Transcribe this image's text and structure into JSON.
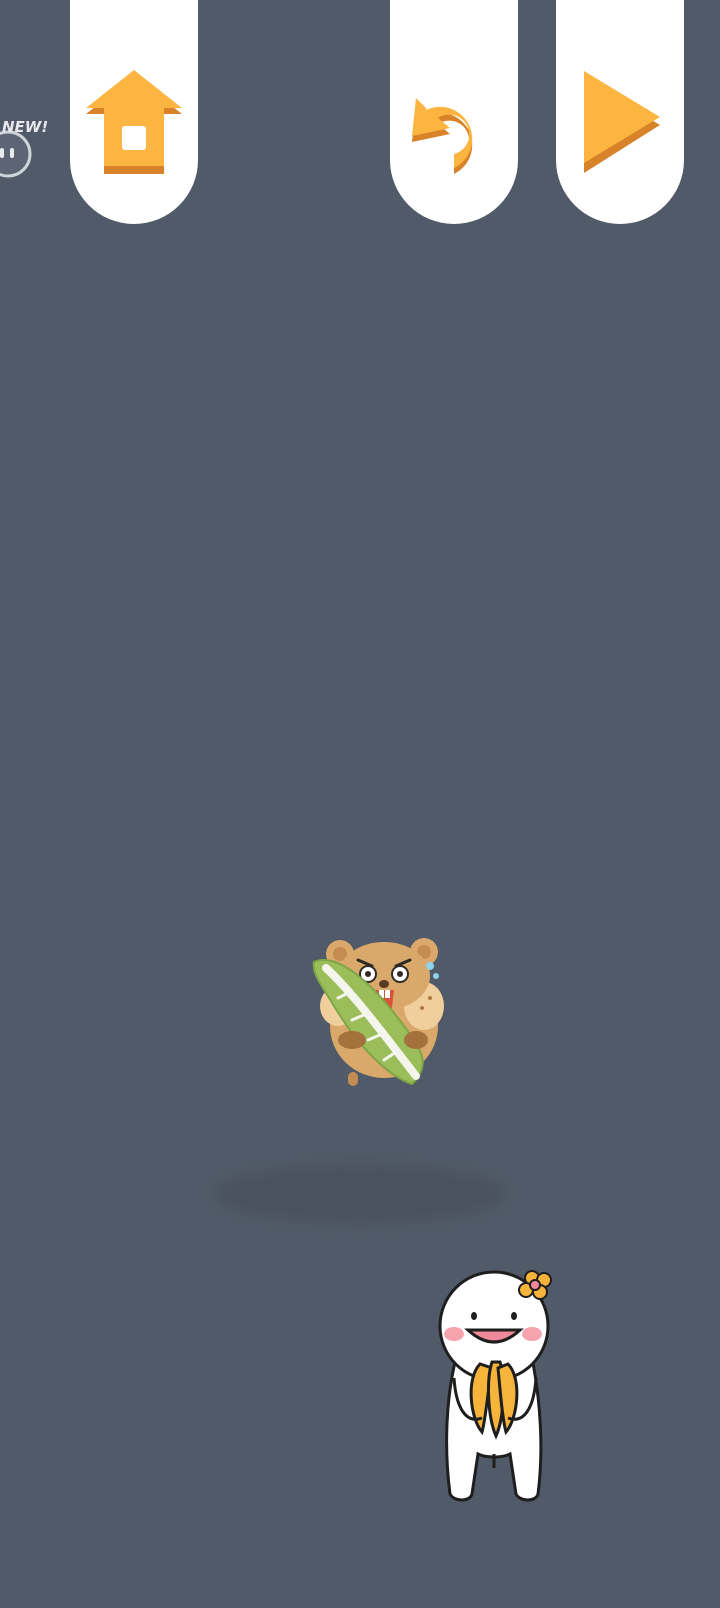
{
  "badge": {
    "text": "NEW!"
  },
  "colors": {
    "background": "#515a68",
    "button_panel": "#ffffff",
    "icon_orange": "#fdb541",
    "icon_shade": "#d8822a"
  },
  "icons": {
    "home": "home-icon",
    "undo": "undo-icon",
    "play": "play-icon"
  }
}
